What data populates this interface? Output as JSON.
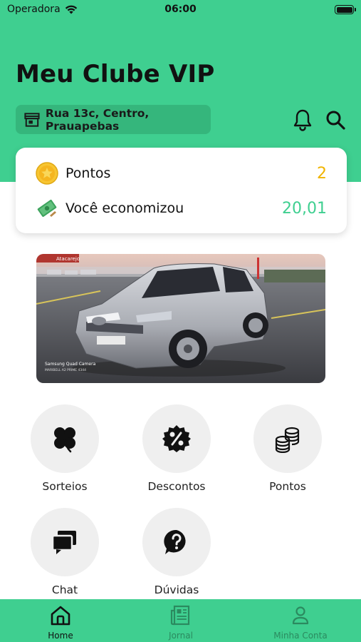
{
  "status_bar": {
    "carrier": "Operadora",
    "time": "06:00"
  },
  "header": {
    "title": "Meu Clube VIP",
    "address": "Rua 13c, Centro, Prauapebas",
    "bell_icon": "bell-icon",
    "search_icon": "search-icon"
  },
  "points_card": {
    "points_label": "Pontos",
    "points_value": "2",
    "points_color": "#f0b400",
    "savings_label": "Você economizou",
    "savings_value": "20,01",
    "savings_color": "#3fcf90"
  },
  "banner": {
    "store_sign": "Atacarejo",
    "camera_brand": "Samsung Quad Camera",
    "camera_credit": "MARIBELL A2 PRIME 4344"
  },
  "tiles": [
    {
      "label": "Sorteios",
      "icon": "clover-icon"
    },
    {
      "label": "Descontos",
      "icon": "percent-badge-icon"
    },
    {
      "label": "Pontos",
      "icon": "coins-icon"
    },
    {
      "label": "Chat",
      "icon": "chat-icon"
    },
    {
      "label": "Dúvidas",
      "icon": "question-icon"
    }
  ],
  "bottom_nav": [
    {
      "label": "Home",
      "icon": "home-icon",
      "active": true
    },
    {
      "label": "Jornal",
      "icon": "newspaper-icon",
      "active": false
    },
    {
      "label": "Minha Conta",
      "icon": "user-icon",
      "active": false
    }
  ],
  "colors": {
    "accent": "#3fcf90",
    "accent_dark": "#35b67c",
    "nav_active": "#111111",
    "nav_inactive": "#2b8a5f"
  }
}
